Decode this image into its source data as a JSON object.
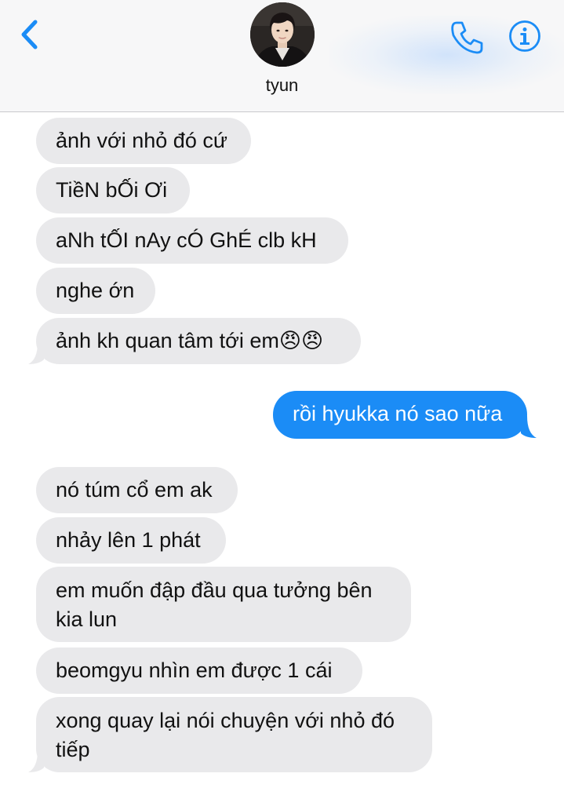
{
  "header": {
    "contact_name": "tyun",
    "back_icon": "chevron-left-icon",
    "call_icon": "phone-icon",
    "info_icon": "info-icon",
    "accent_color": "#1b8cf6"
  },
  "messages": [
    {
      "direction": "received",
      "text": "ảnh với nhỏ đó cứ"
    },
    {
      "direction": "received",
      "text": "TiềN bỐi Ơi"
    },
    {
      "direction": "received",
      "text": "aNh tỐI nAy cÓ GhÉ clb kH"
    },
    {
      "direction": "received",
      "text": "nghe ớn"
    },
    {
      "direction": "received",
      "text": "ảnh kh quan tâm tới em😠😠"
    },
    {
      "direction": "sent",
      "text": "rồi hyukka nó sao nữa"
    },
    {
      "direction": "received",
      "text": "nó túm cổ em ak"
    },
    {
      "direction": "received",
      "text": "nhảy lên 1 phát"
    },
    {
      "direction": "received",
      "text": "em muốn đập đầu qua tưởng bên kia lun"
    },
    {
      "direction": "received",
      "text": "beomgyu nhìn em được 1 cái"
    },
    {
      "direction": "received",
      "text": "xong quay lại nói chuyện với nhỏ đó tiếp"
    }
  ]
}
